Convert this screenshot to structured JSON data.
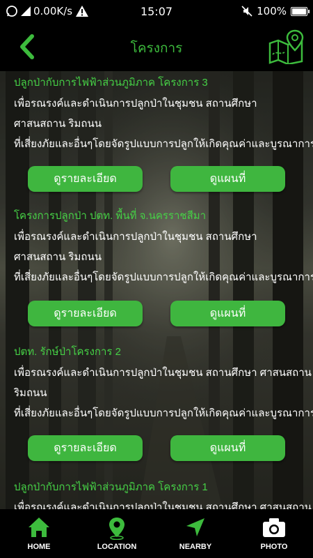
{
  "status": {
    "signal_text": "0.00K/s",
    "time": "15:07",
    "battery": "100%"
  },
  "header": {
    "title": "โครงการ"
  },
  "projects": [
    {
      "title": "ปลูกป่ากับการไฟฟ้าส่วนภูมิภาค โครงการ 3",
      "lines": [
        "เพื่อรณรงค์และดำเนินการปลูกป่าในชุมชน สถานศึกษา",
        "ศาสนสถาน ริมถนน",
        "ที่เสี่ยงภัยและอื่นๆโดยจัดรูปแบบการปลูกให้เกิดคุณค่าและบูรณาการ"
      ],
      "detail_label": "ดูรายละเอียด",
      "map_label": "ดูแผนที่"
    },
    {
      "title": "โครงการปลูกป่า ปตท. พื้นที่ จ.นครราชสีมา",
      "lines": [
        "เพื่อรณรงค์และดำเนินการปลูกป่าในชุมชน สถานศึกษา",
        "ศาสนสถาน ริมถนน",
        "ที่เสี่ยงภัยและอื่นๆโดยจัดรูปแบบการปลูกให้เกิดคุณค่าและบูรณาการ"
      ],
      "detail_label": "ดูรายละเอียด",
      "map_label": "ดูแผนที่"
    },
    {
      "title": "ปตท. รักษ์ป่าโครงการ 2",
      "lines": [
        "เพื่อรณรงค์และดำเนินการปลูกป่าในชุมชน สถานศึกษา ศาสนสถาน",
        "ริมถนน",
        "ที่เสี่ยงภัยและอื่นๆโดยจัดรูปแบบการปลูกให้เกิดคุณค่าและบูรณาการ"
      ],
      "detail_label": "ดูรายละเอียด",
      "map_label": "ดูแผนที่"
    },
    {
      "title": "ปลูกป่ากับการไฟฟ้าส่วนภูมิภาค โครงการ 1",
      "lines": [
        "เพื่อรณรงค์และดำเนินการปลูกป่าในชุมชน สถานศึกษา ศาสนสถาน"
      ]
    }
  ],
  "nav": {
    "home": "HOME",
    "location": "LOCATION",
    "nearby": "NEARBY",
    "photo": "PHOTO"
  },
  "colors": {
    "accent": "#3dbb3d",
    "button": "#3fb63f"
  }
}
